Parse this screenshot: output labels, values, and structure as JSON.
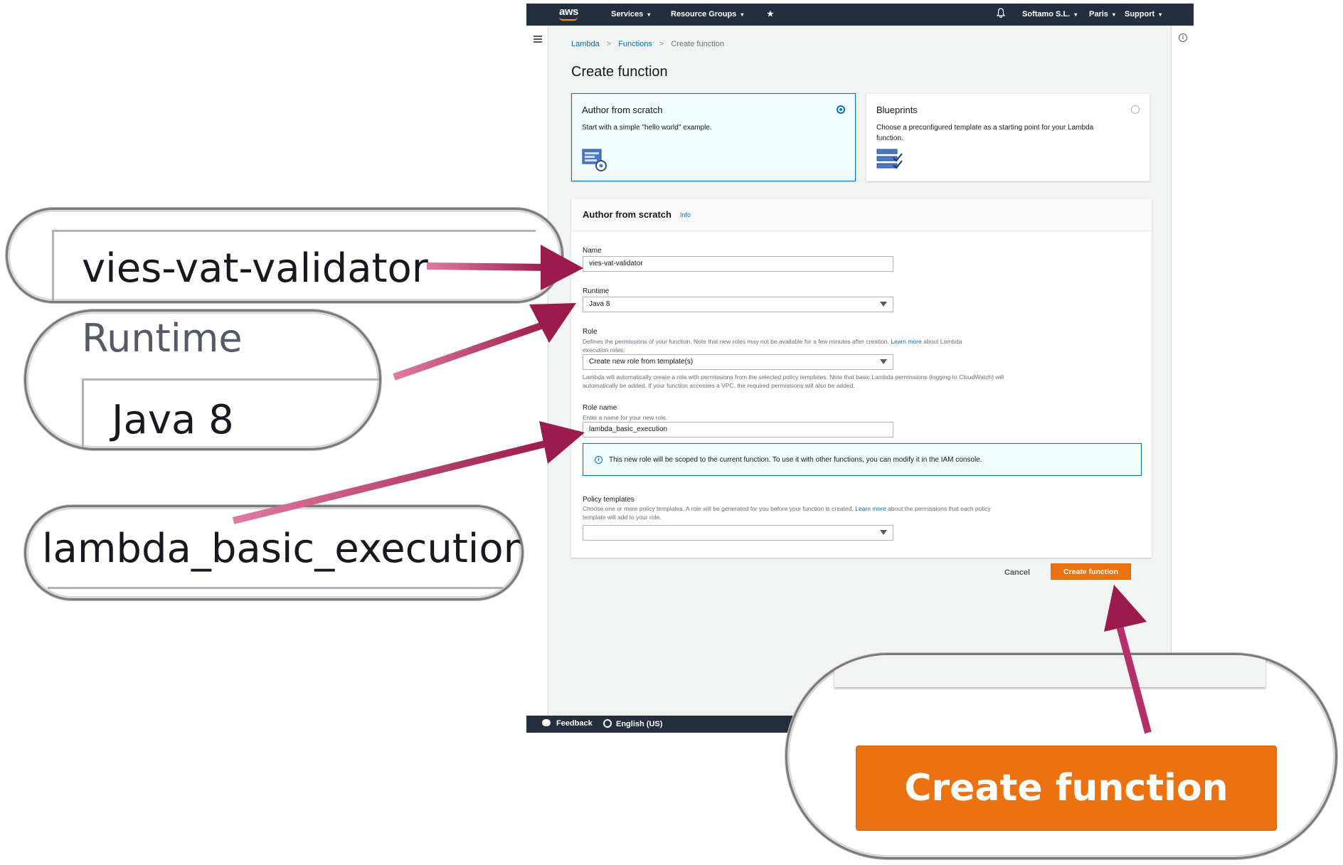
{
  "topnav": {
    "logo": "aws",
    "services": "Services",
    "resource_groups": "Resource Groups",
    "account": "Softamo S.L.",
    "region": "Paris",
    "support": "Support",
    "caret": "▾"
  },
  "breadcrumb": {
    "items": [
      "Lambda",
      "Functions",
      "Create function"
    ],
    "separator": ">"
  },
  "page_title": "Create function",
  "tiles": [
    {
      "title": "Author from scratch",
      "description": "Start with a simple \"hello world\" example.",
      "selected": true,
      "icon": "code-gear-icon"
    },
    {
      "title": "Blueprints",
      "description": "Choose a preconfigured template as a starting point for your Lambda function.",
      "selected": false,
      "icon": "checklist-icon"
    }
  ],
  "form": {
    "title": "Author from scratch",
    "info_link": "Info",
    "name_label": "Name",
    "name_value": "vies-vat-validator",
    "runtime_label": "Runtime",
    "runtime_value": "Java 8",
    "role_label": "Role",
    "role_desc_before": "Defines the permissions of your function. Note that new roles may not be available for a few minutes after creation.",
    "role_desc_link": "Learn more",
    "role_desc_after": "about Lambda execution roles.",
    "role_value": "Create new role from template(s)",
    "role_help": "Lambda will automatically create a role with permissions from the selected policy templates. Note that basic Lambda permissions (logging to CloudWatch) will automatically be added. If your function accesses a VPC, the required permissions will also be added.",
    "role_name_label": "Role name",
    "role_name_desc": "Enter a name for your new role.",
    "role_name_value": "lambda_basic_execution",
    "alert_text": "This new role will be scoped to the current function. To use it with other functions, you can modify it in the IAM console.",
    "policy_label": "Policy templates",
    "policy_desc_before": "Choose one or more policy templates. A role will be generated for you before your function is created.",
    "policy_desc_link": "Learn more",
    "policy_desc_after": "about the permissions that each policy template will add to your role.",
    "policy_value": ""
  },
  "actions": {
    "cancel": "Cancel",
    "create": "Create function"
  },
  "footer": {
    "feedback": "Feedback",
    "language": "English (US)"
  },
  "callouts": {
    "name_zoom": "vies-vat-validator",
    "runtime_zoom_label": "Runtime",
    "runtime_zoom_value": "Java 8",
    "role_zoom": "lambda_basic_execution",
    "create_zoom": "Create function"
  },
  "colors": {
    "nav_bg": "#232f3e",
    "primary_button": "#ec7211",
    "link": "#0073bb",
    "arrow": "#a8215a"
  }
}
